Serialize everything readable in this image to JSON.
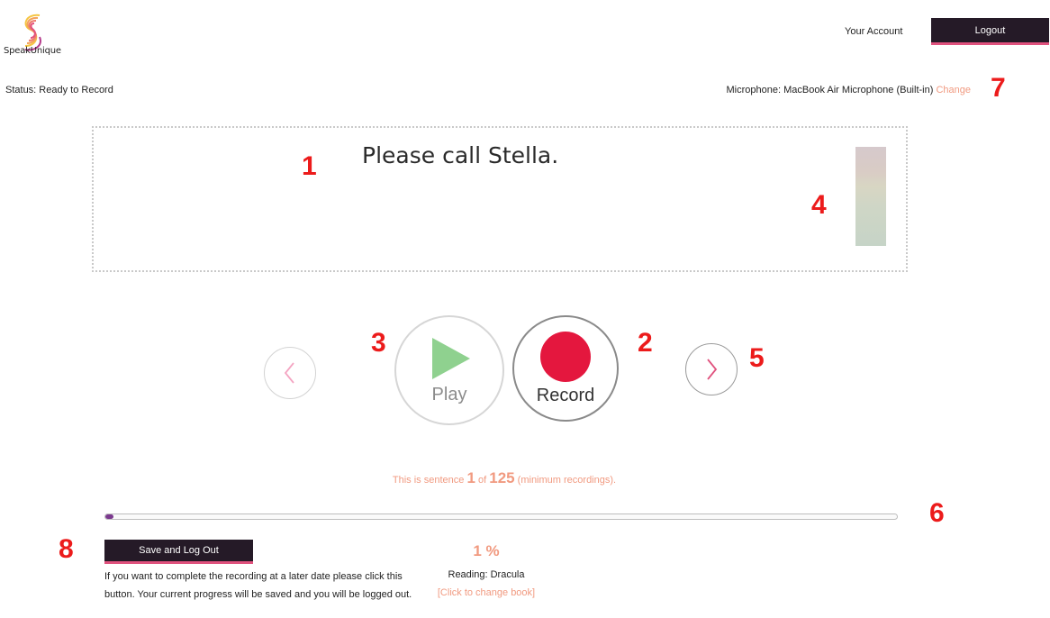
{
  "header": {
    "logo_text": "SpeakUnique",
    "account_label": "Your Account",
    "logout_label": "Logout"
  },
  "status": {
    "text": "Status: Ready to Record"
  },
  "microphone": {
    "text": "Microphone: MacBook Air Microphone (Built-in)",
    "change_label": "Change"
  },
  "sentence": {
    "text": "Please call Stella."
  },
  "level_meter": {
    "level": 1.0
  },
  "controls": {
    "play_label": "Play",
    "record_label": "Record"
  },
  "progress": {
    "prefix": "This is sentence",
    "current": "1",
    "of": "of",
    "total": "125",
    "suffix": "(minimum recordings).",
    "percent_text": "1 %",
    "fraction": 0.01
  },
  "save": {
    "button_label": "Save and Log Out",
    "help_text": "If you want to complete the recording at a later date please click this button. Your current progress will be saved and you will be logged out."
  },
  "book": {
    "reading_text": "Reading: Dracula",
    "change_label": "[Click to change book]"
  },
  "annotations": [
    "1",
    "2",
    "3",
    "4",
    "5",
    "6",
    "7",
    "8"
  ],
  "colors": {
    "accent": "#f19a80",
    "dark": "#251a27",
    "record_red": "#e4173e",
    "play_green": "#8fd18f",
    "annotation_red": "#ec1b1b",
    "progress_purple": "#7b3a8e"
  }
}
